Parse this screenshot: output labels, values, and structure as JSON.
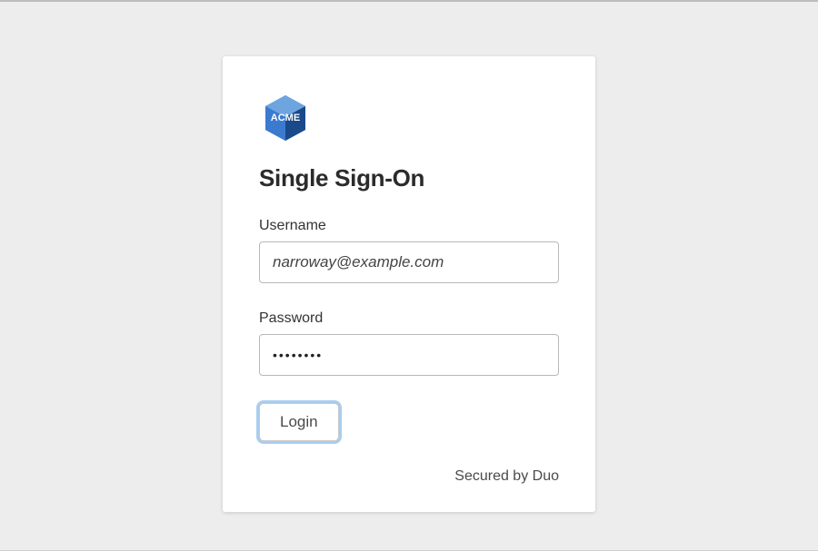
{
  "brand": {
    "logo_text": "ACME",
    "logo_colors": {
      "primary": "#2d6fc4",
      "dark": "#1a4a8a",
      "light": "#6ea5e0"
    }
  },
  "heading": "Single Sign-On",
  "fields": {
    "username": {
      "label": "Username",
      "value": "narroway@example.com"
    },
    "password": {
      "label": "Password",
      "value": "••••••••"
    }
  },
  "login_button_label": "Login",
  "footer_text": "Secured by Duo"
}
